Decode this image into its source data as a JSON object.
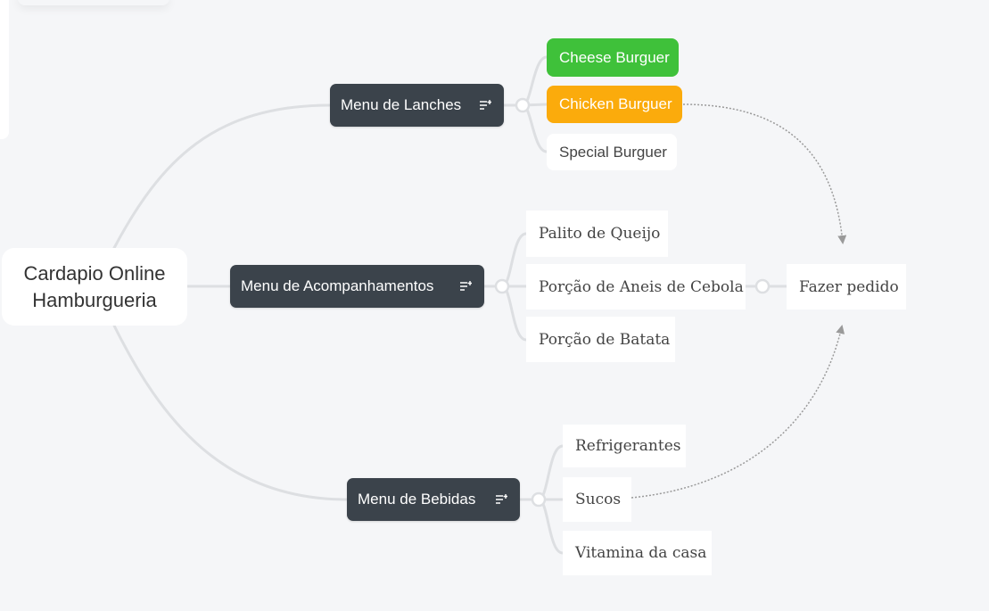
{
  "mindmap": {
    "root": {
      "line1": "Cardapio Online",
      "line2": "Hamburgueria"
    },
    "branches": [
      {
        "label": "Menu de Lanches",
        "icon": "notes-list-icon",
        "items": [
          {
            "label": "Cheese Burguer",
            "color": "#3fc13a"
          },
          {
            "label": "Chicken Burguer",
            "color": "#fbab0c"
          },
          {
            "label": "Special Burguer"
          }
        ]
      },
      {
        "label": "Menu de Acompanhamentos",
        "icon": "notes-list-icon",
        "items": [
          {
            "label": "Palito de Queijo"
          },
          {
            "label": "Porção de Aneis de Cebola"
          },
          {
            "label": "Porção de Batata"
          }
        ]
      },
      {
        "label": "Menu de Bebidas",
        "icon": "notes-list-icon",
        "items": [
          {
            "label": "Refrigerantes"
          },
          {
            "label": "Sucos"
          },
          {
            "label": "Vitamina da casa"
          }
        ]
      }
    ],
    "subtopic": {
      "label": "Fazer pedido"
    },
    "colors": {
      "canvas": "#f5f6f8",
      "branch_fill": "#3b434b",
      "connector": "#dddfe2",
      "relationship": "#9a9a9a"
    }
  }
}
